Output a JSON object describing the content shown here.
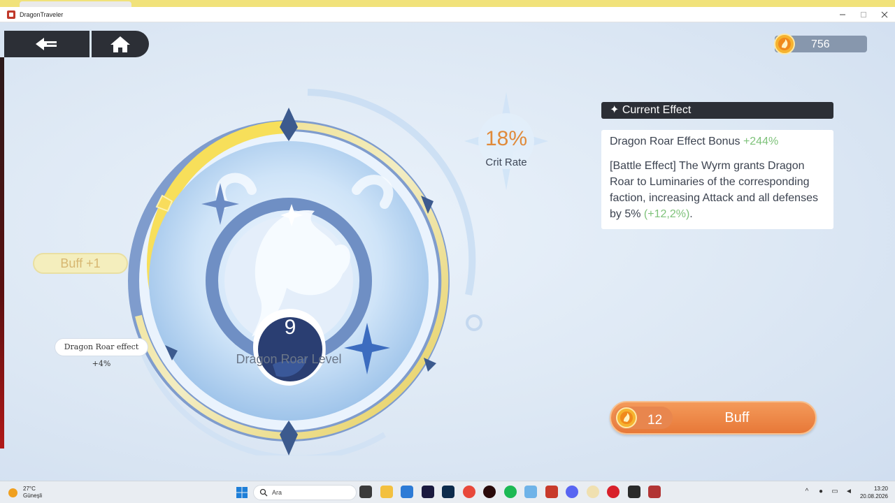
{
  "window": {
    "title": "DragonTraveler"
  },
  "currency": {
    "value": "756",
    "icon": "dragon-coin-icon"
  },
  "dragon": {
    "level": "9",
    "level_label": "Dragon Roar Level"
  },
  "crit": {
    "value": "18%",
    "label": "Crit Rate"
  },
  "buff_pill": {
    "label": "Buff +1"
  },
  "effect_tooltip": {
    "text": "Dragon Roar effect +4%"
  },
  "current_effect": {
    "header": "✦ Current Effect",
    "bonus_label": "Dragon Roar Effect Bonus",
    "bonus_value": "+244%",
    "description": "[Battle Effect] The Wyrm grants Dragon Roar to Luminaries of the corresponding faction, increasing Attack and all defenses by 5%",
    "description_extra": "(+12,2%)",
    "description_end": "."
  },
  "buff_button": {
    "cost": "12",
    "label": "Buff"
  },
  "taskbar": {
    "weather_temp": "27°C",
    "weather_desc": "Güneşli",
    "search_placeholder": "Ara",
    "time": "13:20",
    "date": "20.08.2026"
  },
  "colors": {
    "accent_orange": "#e77838",
    "crit_orange": "#e08a3a",
    "bonus_green": "#7ec27a",
    "dark_panel": "#2c2f36"
  }
}
